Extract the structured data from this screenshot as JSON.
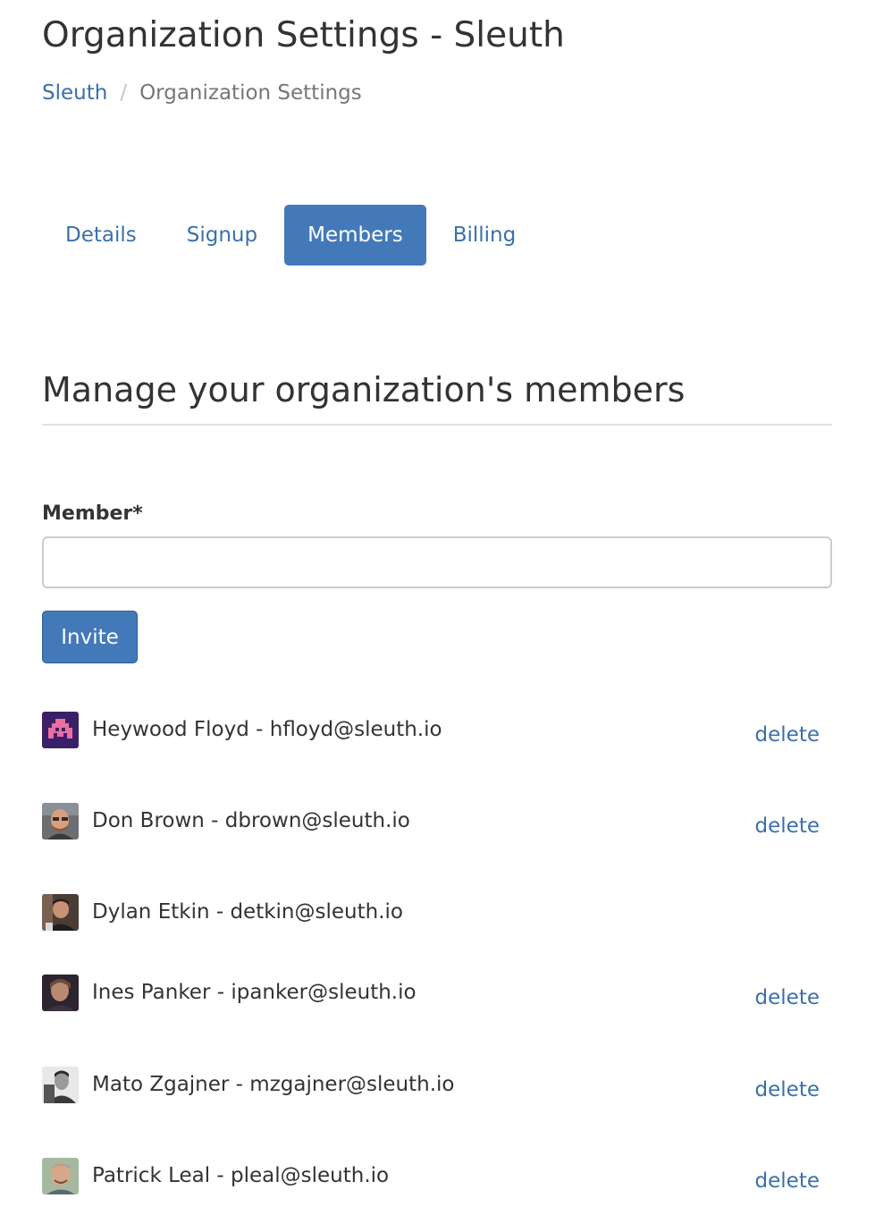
{
  "header": {
    "title": "Organization Settings - Sleuth",
    "breadcrumb": {
      "root": "Sleuth",
      "separator": "/",
      "current": "Organization Settings"
    }
  },
  "tabs": [
    {
      "label": "Details",
      "active": false
    },
    {
      "label": "Signup",
      "active": false
    },
    {
      "label": "Members",
      "active": true
    },
    {
      "label": "Billing",
      "active": false
    }
  ],
  "members_section": {
    "title": "Manage your organization's members",
    "field_label": "Member*",
    "input_value": "",
    "invite_label": "Invite"
  },
  "members": [
    {
      "text": "Heywood Floyd - hfloyd@sleuth.io",
      "delete": "delete",
      "avatar": "pixel-art-avatar"
    },
    {
      "text": "Don Brown - dbrown@sleuth.io",
      "delete": "delete",
      "avatar": "photo-avatar"
    },
    {
      "text": "Dylan Etkin - detkin@sleuth.io",
      "delete": "",
      "avatar": "photo-avatar"
    },
    {
      "text": "Ines Panker - ipanker@sleuth.io",
      "delete": "delete",
      "avatar": "photo-avatar"
    },
    {
      "text": "Mato Zgajner - mzgajner@sleuth.io",
      "delete": "delete",
      "avatar": "photo-avatar"
    },
    {
      "text": "Patrick Leal - pleal@sleuth.io",
      "delete": "delete",
      "avatar": "photo-avatar"
    }
  ],
  "colors": {
    "link": "#3a70ad",
    "primary": "#4379b9",
    "text": "#333333",
    "muted": "#777777"
  }
}
